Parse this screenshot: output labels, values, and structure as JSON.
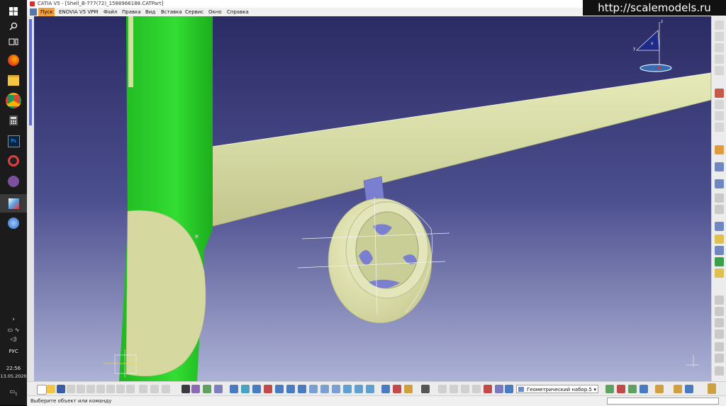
{
  "watermark": "http://scalemodels.ru",
  "taskbar": {
    "lang": "РУС",
    "time": "22:56",
    "date": "13.05.2020",
    "notification_count": "1",
    "icons": [
      "windows-start",
      "search",
      "task-view",
      "firefox",
      "file-explorer",
      "chrome",
      "calculator",
      "photoshop",
      "recorder",
      "viber",
      "catia",
      "other-app"
    ]
  },
  "window": {
    "title": "CATIA V5 - [Shell_B-777(72)_1588966188.CATPart]"
  },
  "menu": {
    "items": [
      "Пуск",
      "ENOVIA V5 VPM",
      "Файл",
      "Правка",
      "Вид",
      "Вставка",
      "Сервис",
      "Окно",
      "Справка"
    ],
    "selected": "Пуск"
  },
  "toolbar": {
    "geometric_set": "Геометрический набор.5"
  },
  "status": {
    "message": "Выберите объект или команду"
  },
  "compass": {
    "x_label": "x",
    "y_label": "y",
    "z_label": "z"
  },
  "colors": {
    "viewport_top": "#2e2e66",
    "viewport_bottom": "#a9aed2",
    "fuselage_green": "#22cc22",
    "surface_beige": "#dadfa6",
    "accent_blue": "#6d73c8",
    "menu_selected": "#f0a040"
  }
}
